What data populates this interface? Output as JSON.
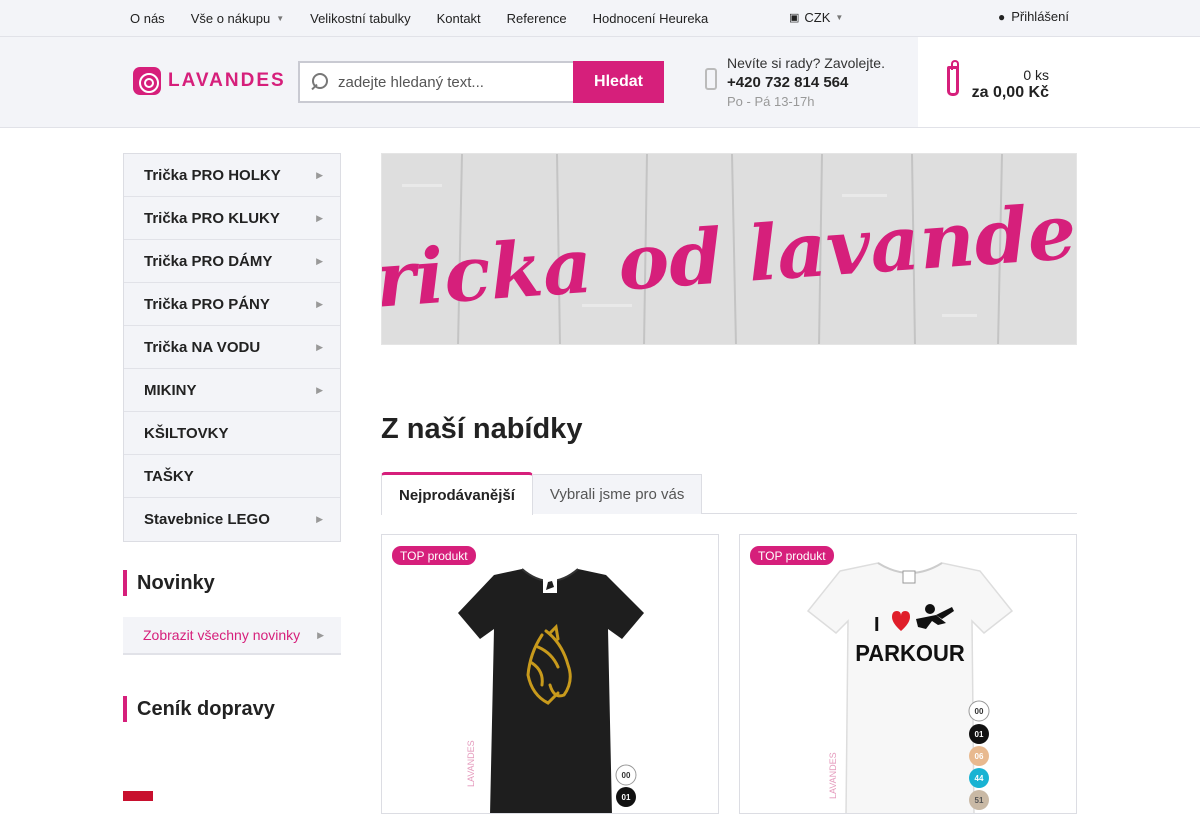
{
  "topbar": {
    "links": [
      {
        "label": "O nás"
      },
      {
        "label": "Vše o nákupu"
      },
      {
        "label": "Velikostní tabulky"
      },
      {
        "label": "Kontakt"
      },
      {
        "label": "Reference"
      },
      {
        "label": "Hodnocení Heureka"
      }
    ],
    "currency": "CZK",
    "login": "Přihlášení"
  },
  "header": {
    "logo_text": "LAVANDES",
    "search_placeholder": "zadejte hledaný text...",
    "search_button": "Hledat",
    "contact_question": "Nevíte si rady? Zavolejte.",
    "contact_phone": "+420 732 814 564",
    "contact_hours": "Po - Pá 13-17h",
    "cart_count": "0 ks",
    "cart_total": "za 0,00 Kč"
  },
  "sidebar": {
    "categories": [
      {
        "label": "Trička PRO HOLKY",
        "has_sub": true
      },
      {
        "label": "Trička PRO KLUKY",
        "has_sub": true
      },
      {
        "label": "Trička PRO DÁMY",
        "has_sub": true
      },
      {
        "label": "Trička PRO PÁNY",
        "has_sub": true
      },
      {
        "label": "Trička NA VODU",
        "has_sub": true
      },
      {
        "label": "MIKINY",
        "has_sub": true
      },
      {
        "label": "KŠILTOVKY",
        "has_sub": false
      },
      {
        "label": "TAŠKY",
        "has_sub": false
      },
      {
        "label": "Stavebnice LEGO",
        "has_sub": true
      }
    ],
    "news_title": "Novinky",
    "news_link": "Zobrazit všechny novinky",
    "shipping_title": "Ceník dopravy"
  },
  "banner": {
    "text": "tricka od lavandes"
  },
  "main": {
    "title": "Z naší nabídky",
    "tabs": [
      {
        "label": "Nejprodávanější",
        "active": true
      },
      {
        "label": "Vybrali jsme pro vás",
        "active": false
      }
    ],
    "products": [
      {
        "badge": "TOP produkt",
        "shirt_color": "#1e1e1e",
        "color_codes": [
          "00",
          "01"
        ]
      },
      {
        "badge": "TOP produkt",
        "shirt_color": "#ffffff",
        "print_text": "PARKOUR",
        "print_prefix": "I",
        "color_codes": [
          "00",
          "01",
          "06",
          "44",
          "51"
        ]
      }
    ]
  },
  "colors": {
    "accent": "#d61f7b",
    "bar_bg": "#f3f4f8"
  }
}
